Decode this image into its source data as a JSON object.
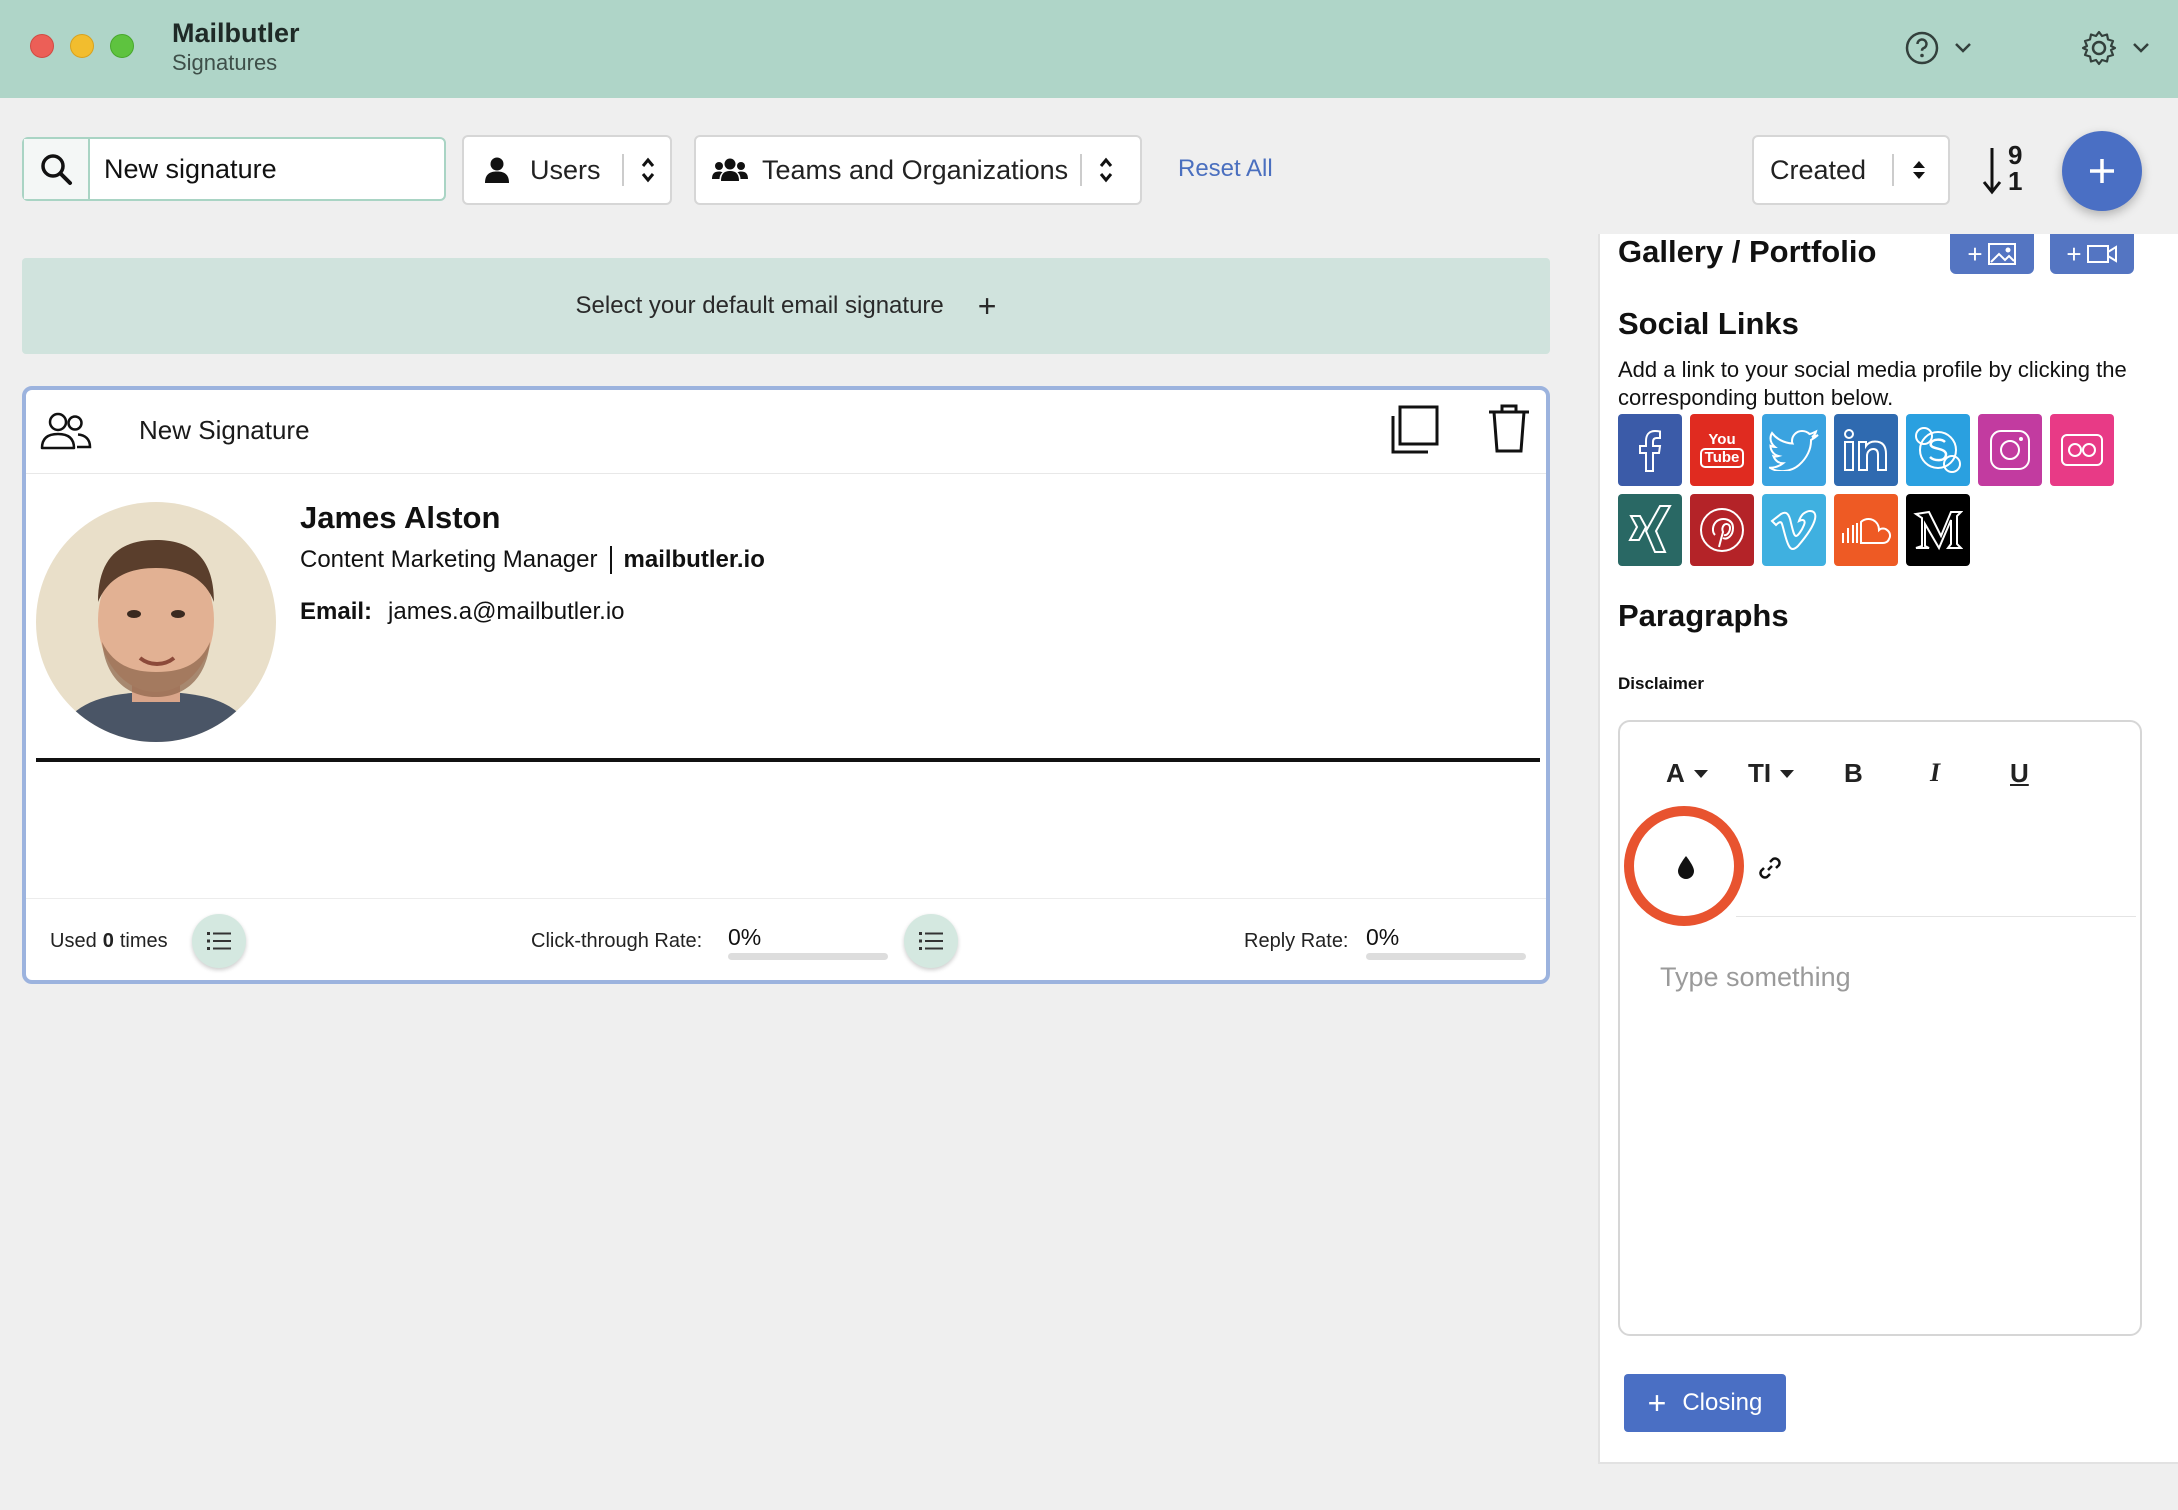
{
  "app": {
    "name": "Mailbutler",
    "section": "Signatures"
  },
  "icons": {
    "help": "help-icon",
    "settings": "gear-icon",
    "search": "search-icon",
    "user": "user-icon",
    "team": "team-icon",
    "sort": "sort-numeric-icon",
    "add": "plus-icon",
    "copy": "copy-icon",
    "trash": "trash-icon",
    "list": "list-icon",
    "color": "color-drop-icon",
    "link": "link-icon"
  },
  "toolbar": {
    "search_value": "New signature",
    "users_label": "Users",
    "teams_label": "Teams and Organizations",
    "reset_label": "Reset All",
    "sort_label": "Created",
    "sort_digits_top": "9",
    "sort_digits_bottom": "1"
  },
  "default_banner": {
    "text": "Select your default email signature",
    "plus": "+"
  },
  "signature_card": {
    "title": "New Signature",
    "name": "James Alston",
    "job_title": "Content Marketing Manager",
    "company": "mailbutler.io",
    "email_label": "Email:",
    "email": "james.a@mailbutler.io",
    "used_prefix": "Used",
    "used_count": "0",
    "used_suffix": "times",
    "ctr_label": "Click-through Rate:",
    "ctr_value": "0%",
    "reply_label": "Reply Rate:",
    "reply_value": "0%",
    "ctr_fraction": 0,
    "reply_fraction": 0
  },
  "right_panel": {
    "gallery_title": "Gallery / Portfolio",
    "gallery_image_btn": "+",
    "gallery_video_btn": "+",
    "social_title": "Social Links",
    "social_desc": "Add a link to your social media profile by clicking the corresponding button below.",
    "social": [
      {
        "name": "facebook",
        "color": "#3b5ba8"
      },
      {
        "name": "youtube",
        "color": "#e02b20",
        "text": "You Tube"
      },
      {
        "name": "twitter",
        "color": "#3aa3e0"
      },
      {
        "name": "linkedin",
        "color": "#2f6ab0"
      },
      {
        "name": "skype",
        "color": "#2aa0e0"
      },
      {
        "name": "instagram",
        "color": "#c23ba0"
      },
      {
        "name": "flickr",
        "color": "#e83a86"
      },
      {
        "name": "xing",
        "color": "#296864"
      },
      {
        "name": "pinterest",
        "color": "#b42328"
      },
      {
        "name": "vimeo",
        "color": "#3fb0e0"
      },
      {
        "name": "soundcloud",
        "color": "#ee5a24"
      },
      {
        "name": "medium",
        "color": "#000000"
      }
    ],
    "paragraphs_title": "Paragraphs",
    "disclaimer_label": "Disclaimer",
    "editor": {
      "font_label": "A",
      "size_label": "TI",
      "bold_label": "B",
      "italic_label": "I",
      "underline_label": "U",
      "placeholder": "Type something"
    },
    "closing_label": "Closing",
    "closing_plus": "+"
  },
  "colors": {
    "titlebar": "#afd5c8",
    "accent": "#4a6fc4",
    "highlight": "#e8532f"
  }
}
